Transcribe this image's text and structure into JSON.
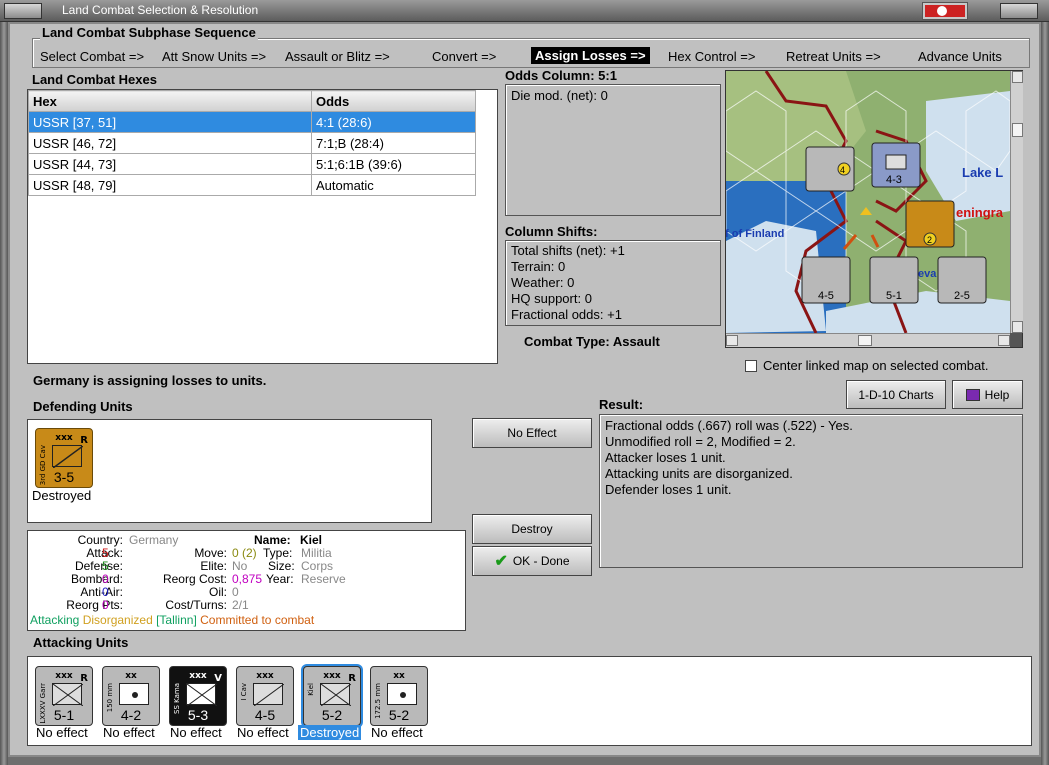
{
  "window": {
    "title": "Land Combat Selection & Resolution"
  },
  "subphase": {
    "title": "Land Combat Subphase Sequence",
    "steps": [
      "Select Combat =>",
      "Att Snow Units =>",
      "Assault or Blitz =>",
      "Convert =>",
      "Assign Losses =>",
      "Hex Control =>",
      "Retreat Units =>",
      "Advance Units"
    ],
    "active": "Assign Losses =>"
  },
  "hexes": {
    "title": "Land Combat Hexes",
    "columns": [
      "Hex",
      "Odds"
    ],
    "rows": [
      [
        "USSR [37, 51]",
        "4:1 (28:6)"
      ],
      [
        "USSR [46, 72]",
        "7:1;B (28:4)"
      ],
      [
        "USSR [44, 73]",
        "5:1;6:1B (39:6)"
      ],
      [
        "USSR [48, 79]",
        "Automatic"
      ]
    ]
  },
  "odds": {
    "title": "Odds Column: 5:1",
    "die_mod": "Die mod. (net): 0"
  },
  "shifts": {
    "title": "Column Shifts:",
    "lines": [
      "Total shifts (net): +1",
      "Terrain: 0",
      "Weather: 0",
      "HQ support: 0",
      "Fractional odds: +1"
    ]
  },
  "combat_type": "Combat Type:  Assault",
  "map": {
    "labels": {
      "lake": "Lake L",
      "gulf": "lf of Finland",
      "city": "eningra",
      "neva": "eva"
    },
    "center_link_label": "Center linked map on selected combat.",
    "units": [
      {
        "size": "xxx",
        "num": "4-3",
        "corner": "R"
      },
      {
        "size": "xxx",
        "num": "4-5",
        "corner": ""
      },
      {
        "size": "xxx",
        "num": "5-1",
        "corner": "R"
      },
      {
        "size": "xx",
        "num": "2-5",
        "corner": ""
      }
    ]
  },
  "status": "Germany is assigning losses to units.",
  "defending": {
    "title": "Defending Units",
    "unit": {
      "size": "xxx",
      "name": "3rd GD Cav",
      "num": "3-5",
      "corner": "R",
      "caption": "Destroyed"
    }
  },
  "buttons": {
    "no_effect": "No Effect",
    "destroy": "Destroy",
    "ok": "OK - Done",
    "charts": "1-D-10 Charts",
    "help": "Help"
  },
  "result": {
    "title": "Result:",
    "lines": [
      "Fractional odds (.667) roll was (.522)  - Yes.",
      "Unmodified roll = 2, Modified = 2.",
      "Attacker loses 1 unit.",
      "Attacking units are disorganized.",
      "Defender loses 1 unit."
    ]
  },
  "unit_info": {
    "country_label": "Country:",
    "country": "Germany",
    "attack_label": "Attack:",
    "attack": "5",
    "defense_label": "Defense:",
    "defense": "5",
    "bombard_label": "Bombard:",
    "bombard": "0",
    "antiair_label": "Anti-Air:",
    "antiair": "0",
    "reorg_pts_label": "Reorg Pts:",
    "reorg_pts": "0",
    "name_label": "Name:",
    "name": "Kiel",
    "move_label": "Move:",
    "move": "0 (2)",
    "type_label": "Type:",
    "type": "Militia",
    "elite_label": "Elite:",
    "elite": "No",
    "size_label": "Size:",
    "size": "Corps",
    "reorg_cost_label": "Reorg Cost:",
    "reorg_cost": "0,875",
    "year_label": "Year:",
    "year": "Reserve",
    "oil_label": "Oil:",
    "oil": "0",
    "cost_turns_label": "Cost/Turns:",
    "cost_turns": "2/1",
    "status_attacking": "Attacking",
    "status_disorg": "Disorganized",
    "status_loc": "[Tallinn]",
    "status_committed": "Committed to combat"
  },
  "attacking": {
    "title": "Attacking Units",
    "units": [
      {
        "size": "xxx",
        "name": "LXXXV Garr",
        "num": "5-1",
        "corner": "R",
        "caption": "No effect"
      },
      {
        "size": "xx",
        "name": "150 mm",
        "num": "4-2",
        "corner": "",
        "caption": "No effect"
      },
      {
        "size": "xxx",
        "name": "SS Kama",
        "num": "5-3",
        "corner": "V",
        "caption": "No effect"
      },
      {
        "size": "xxx",
        "name": "I Cav",
        "num": "4-5",
        "corner": "",
        "caption": "No effect"
      },
      {
        "size": "xxx",
        "name": "Kiel",
        "num": "5-2",
        "corner": "R",
        "caption": "Destroyed"
      },
      {
        "size": "xx",
        "name": "172.5 mm",
        "num": "5-2",
        "corner": "",
        "caption": "No effect"
      }
    ]
  },
  "colors": {
    "selection": "#2f8be0",
    "attack": "#d01818",
    "defense": "#1a8a1a",
    "bombard": "#c000c0",
    "antiair": "#1a1ac0",
    "reorg": "#c000c0",
    "disorg": "#d0a020",
    "committed": "#d06010",
    "attacking": "#10a060"
  }
}
